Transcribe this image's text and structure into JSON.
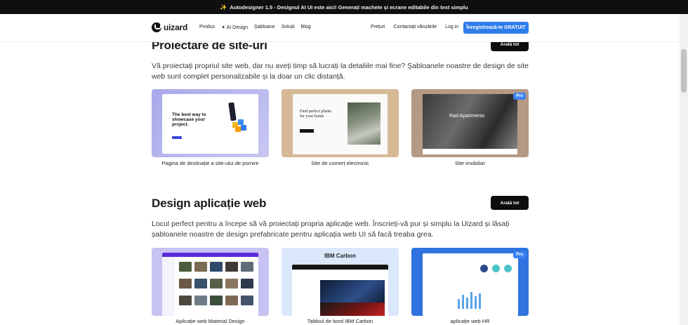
{
  "announcement": {
    "spark": "✨",
    "text": "Autodesigner 1.5 - Designul AI UI este aici! Generați machete și ecrane editabile din text simplu"
  },
  "nav": {
    "logo": "uizard",
    "links": [
      "Produs",
      "AI Design",
      "Șabloane",
      "Soluții",
      "Blog"
    ],
    "right_links": [
      "Prețuri",
      "Contactați vânzările",
      "Log in"
    ],
    "cta": "Înregistrează-te GRATUIT"
  },
  "sections": [
    {
      "title": "Proiectare de site-uri",
      "see_all": "Arată tot",
      "description": "Vă proiectați propriul site web, dar nu aveți timp să lucrați la detaliile mai fine? Șabloanele noastre de design de site web sunt complet personalizabile și la doar un clic distanță.",
      "cards": [
        {
          "label": "Pagina de destinație a site-ului de pornire",
          "preview_text": "The best way to showcase your project."
        },
        {
          "label": "Site de comerț electronic",
          "preview_text": "Find perfect plants for your home"
        },
        {
          "label": "Site imobiliar",
          "preview_text": "Rad Apartments",
          "badge": "Pro"
        }
      ]
    },
    {
      "title": "Design aplicație web",
      "see_all": "Arată tot",
      "description": "Locul perfect pentru a începe să vă proiectați propria aplicație web. Înscrieți-vă pur și simplu la Uizard și lăsați șabloanele noastre de design prefabricate pentru aplicația web UI să facă treaba grea.",
      "cards": [
        {
          "label": "Aplicație web Material Design"
        },
        {
          "label": "Tabloul de bord IBM Carbon",
          "preview_text": "IBM Carbon"
        },
        {
          "label": "aplicație web HR",
          "badge": "Pro"
        }
      ]
    }
  ],
  "colors": {
    "accent": "#2f7dea",
    "ai_link": "#5a4bff",
    "dark_button": "#0d0d0d",
    "announce_bg": "#0f0f12"
  }
}
